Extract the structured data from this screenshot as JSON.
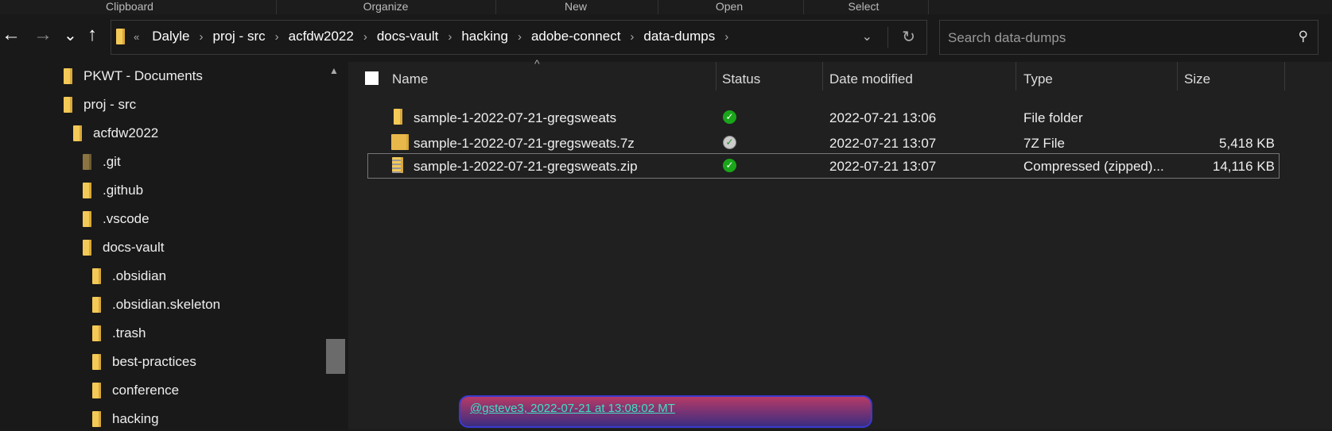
{
  "ribbon": {
    "groups": [
      "Clipboard",
      "Organize",
      "New",
      "Open",
      "Select"
    ]
  },
  "nav": {
    "back": "←",
    "forward": "→",
    "recent": "⌄",
    "up": "↑"
  },
  "address": {
    "overflow": "«",
    "crumbs": [
      "Dalyle",
      "proj - src",
      "acfdw2022",
      "docs-vault",
      "hacking",
      "adobe-connect",
      "data-dumps"
    ]
  },
  "search": {
    "placeholder": "Search data-dumps"
  },
  "sidebar": {
    "items": [
      {
        "label": "PKWT - Documents"
      },
      {
        "label": "proj - src"
      },
      {
        "label": "acfdw2022"
      },
      {
        "label": ".git",
        "hidden": true
      },
      {
        "label": ".github"
      },
      {
        "label": ".vscode"
      },
      {
        "label": "docs-vault"
      },
      {
        "label": ".obsidian"
      },
      {
        "label": ".obsidian.skeleton"
      },
      {
        "label": ".trash"
      },
      {
        "label": "best-practices"
      },
      {
        "label": "conference"
      },
      {
        "label": "hacking"
      }
    ]
  },
  "columns": {
    "name": "Name",
    "status": "Status",
    "date": "Date modified",
    "type": "Type",
    "size": "Size"
  },
  "files": [
    {
      "name": "sample-1-2022-07-21-gregsweats",
      "status": "synced",
      "date": "2022-07-21 13:06",
      "type": "File folder",
      "size": ""
    },
    {
      "name": "sample-1-2022-07-21-gregsweats.7z",
      "status": "available",
      "date": "2022-07-21 13:07",
      "type": "7Z File",
      "size": "5,418 KB"
    },
    {
      "name": "sample-1-2022-07-21-gregsweats.zip",
      "status": "synced",
      "date": "2022-07-21 13:07",
      "type": "Compressed (zipped)...",
      "size": "14,116 KB",
      "selected": true
    }
  ],
  "tooltip": {
    "text": "@gsteve3, 2022-07-21 at 13:08:02 MT"
  }
}
